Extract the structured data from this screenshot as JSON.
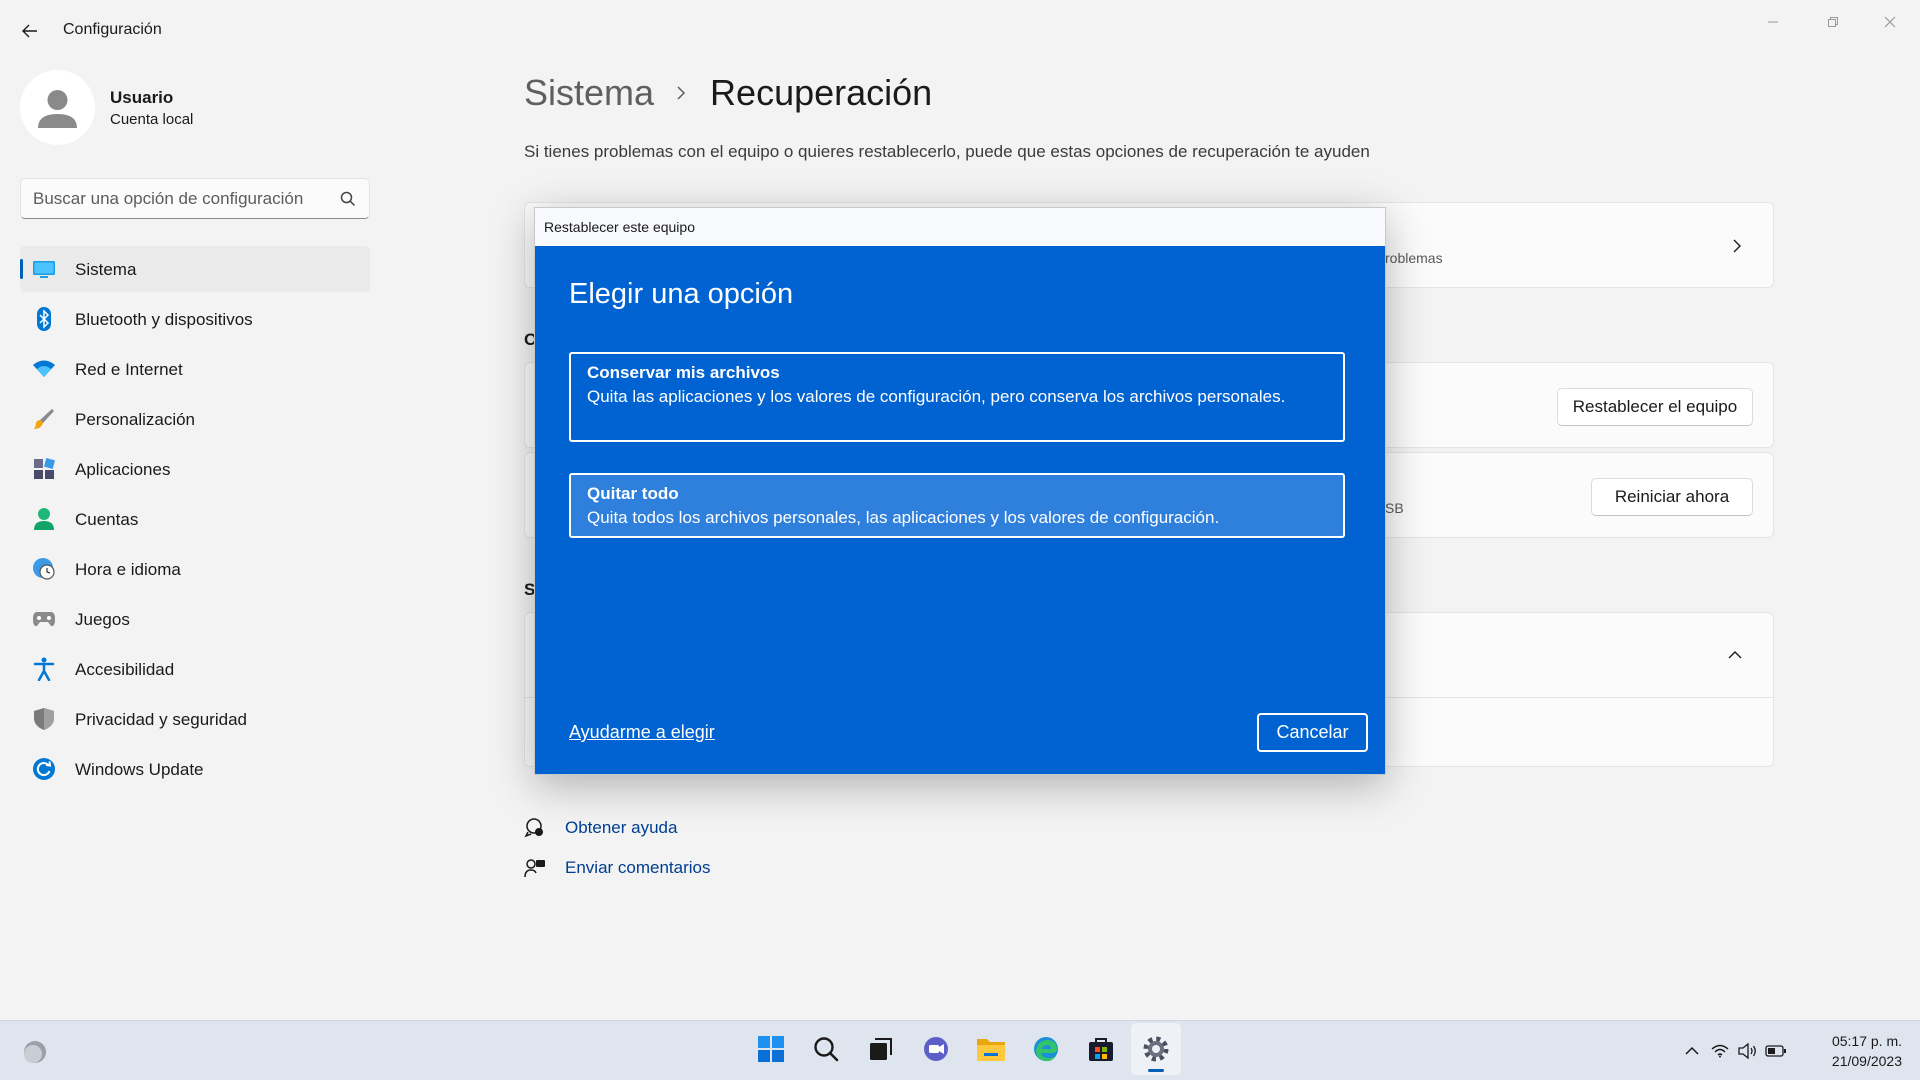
{
  "window": {
    "title": "Configuración"
  },
  "user": {
    "name": "Usuario",
    "account_type": "Cuenta local"
  },
  "search": {
    "placeholder": "Buscar una opción de configuración"
  },
  "sidebar": {
    "items": [
      {
        "label": "Sistema",
        "icon": "system-icon",
        "active": true
      },
      {
        "label": "Bluetooth y dispositivos",
        "icon": "bluetooth-icon"
      },
      {
        "label": "Red e Internet",
        "icon": "wifi-icon"
      },
      {
        "label": "Personalización",
        "icon": "brush-icon"
      },
      {
        "label": "Aplicaciones",
        "icon": "apps-icon"
      },
      {
        "label": "Cuentas",
        "icon": "person-icon"
      },
      {
        "label": "Hora e idioma",
        "icon": "clock-globe-icon"
      },
      {
        "label": "Juegos",
        "icon": "gamepad-icon"
      },
      {
        "label": "Accesibilidad",
        "icon": "accessibility-icon"
      },
      {
        "label": "Privacidad y seguridad",
        "icon": "shield-icon"
      },
      {
        "label": "Windows Update",
        "icon": "update-icon"
      }
    ]
  },
  "main": {
    "breadcrumb_parent": "Sistema",
    "breadcrumb_current": "Recuperación",
    "description": "Si tienes problemas con el equipo o quieres restablecerlo, puede que estas opciones de recuperación te ayuden",
    "card1_subtitle_fragment": "roblemas",
    "section_o_fragment": "O",
    "reset_button": "Restablecer el equipo",
    "card3_subtitle_fragment": "SB",
    "restart_button": "Reiniciar ahora",
    "section_s_fragment": "S",
    "help_links": [
      {
        "label": "Obtener ayuda",
        "icon": "help-chat-icon"
      },
      {
        "label": "Enviar comentarios",
        "icon": "feedback-icon"
      }
    ]
  },
  "dialog": {
    "title": "Restablecer este equipo",
    "heading": "Elegir una opción",
    "options": [
      {
        "title": "Conservar mis archivos",
        "description": "Quita las aplicaciones y los valores de configuración, pero conserva los archivos personales."
      },
      {
        "title": "Quitar todo",
        "description": "Quita todos los archivos personales, las aplicaciones y los valores de configuración."
      }
    ],
    "help_link": "Ayudarme a elegir",
    "cancel_button": "Cancelar"
  },
  "taskbar": {
    "apps": [
      "start-icon",
      "search-icon",
      "task-view-icon",
      "chat-icon",
      "file-explorer-icon",
      "edge-icon",
      "store-icon",
      "settings-icon"
    ],
    "active_app": "settings-icon",
    "time": "05:17 p. m.",
    "date": "21/09/2023"
  },
  "colors": {
    "accent": "#005fb8",
    "dialog_blue": "#0063d1",
    "link": "#003e92"
  }
}
